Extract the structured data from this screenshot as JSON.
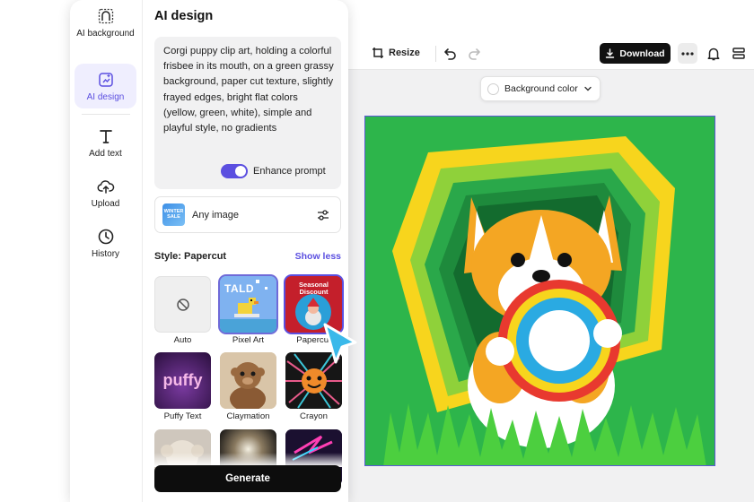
{
  "sidebar": {
    "items": [
      {
        "label": "AI background"
      },
      {
        "label": "AI design"
      },
      {
        "label": "Add text"
      },
      {
        "label": "Upload"
      },
      {
        "label": "History"
      }
    ]
  },
  "panel": {
    "title": "AI design",
    "prompt": "Corgi puppy clip art, holding a colorful frisbee in its mouth, on a green grassy background, paper cut texture, slightly frayed edges, bright flat colors (yellow, green, white), simple and playful style, no gradients",
    "enhance_label": "Enhance prompt",
    "enhance_on": true,
    "image_type": "Any image",
    "image_type_thumb_text": "WINTER SALE",
    "style_label": "Style: Papercut",
    "show_less_label": "Show less",
    "styles": [
      {
        "label": "Auto"
      },
      {
        "label": "Pixel Art",
        "thumb_text": "TALD"
      },
      {
        "label": "Papercut",
        "thumb_text": "Seasonal Discount"
      },
      {
        "label": "Puffy Text",
        "thumb_text": "puffy"
      },
      {
        "label": "Claymation"
      },
      {
        "label": "Crayon"
      },
      {
        "label": ""
      },
      {
        "label": ""
      },
      {
        "label": ""
      }
    ],
    "generate_label": "Generate"
  },
  "toolbar": {
    "resize_label": "Resize",
    "download_label": "Download"
  },
  "canvas": {
    "background_color_label": "Background color"
  },
  "colors": {
    "accent": "#5b4fe0",
    "download_bg": "#111111",
    "canvas_green": "#2db54b"
  }
}
